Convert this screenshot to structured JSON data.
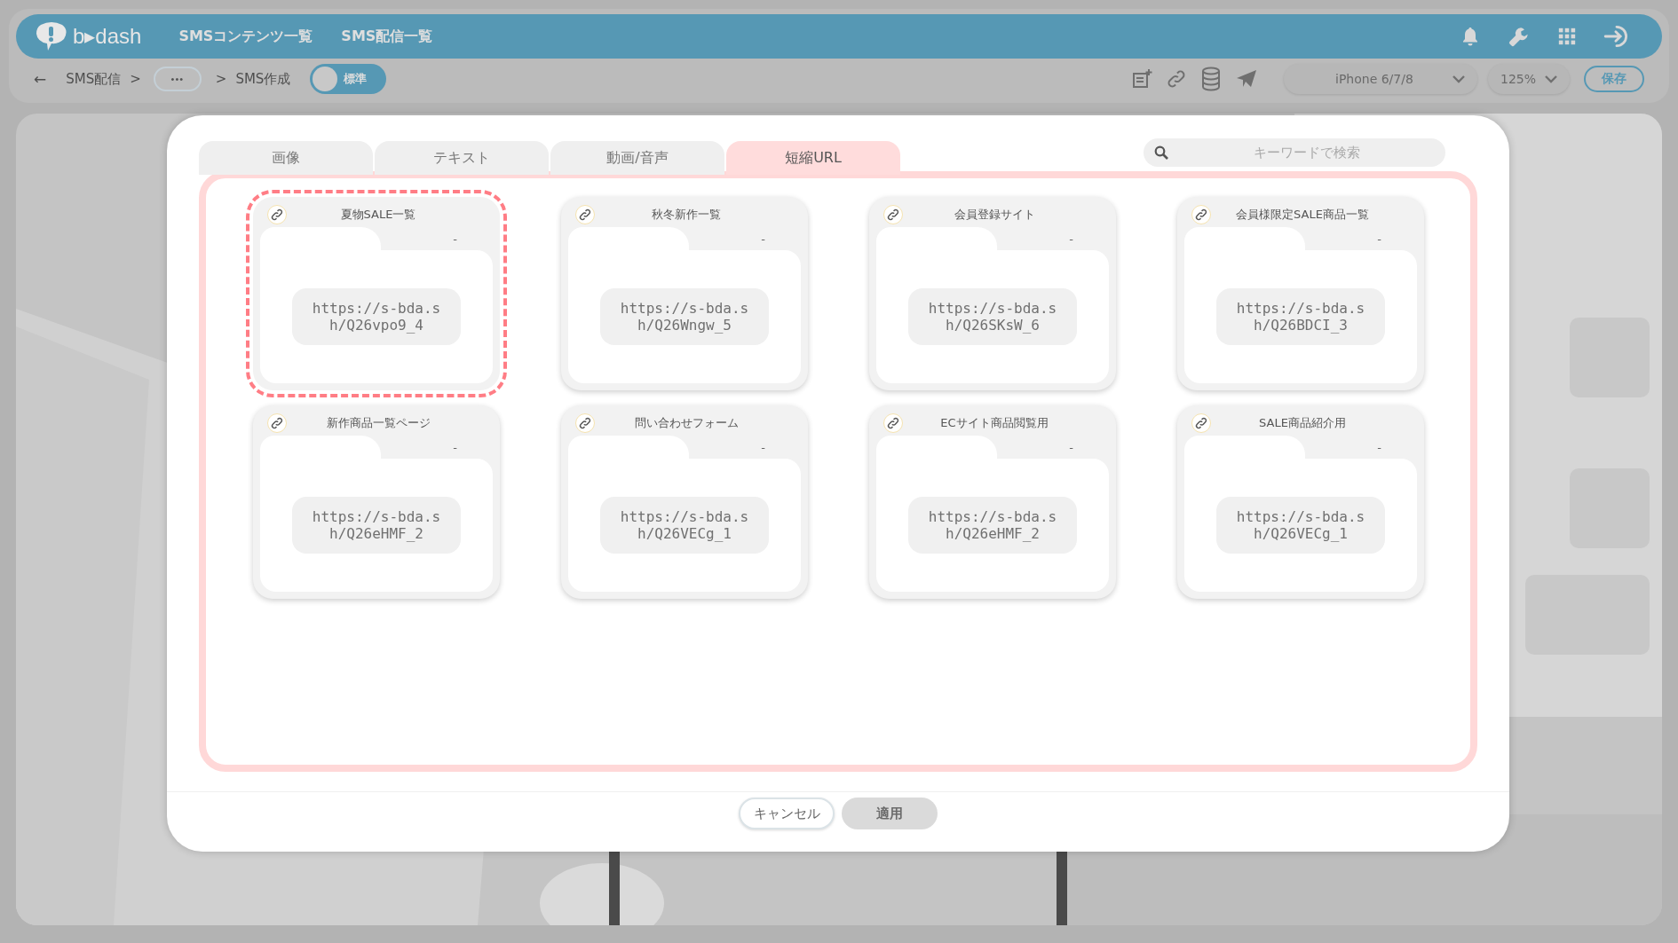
{
  "header": {
    "logo": "b▸dash",
    "nav": [
      "SMSコンテンツ一覧",
      "SMS配信一覧"
    ]
  },
  "toolbar": {
    "back": "←",
    "breadcrumb": [
      "SMS配信",
      ">"
    ],
    "more": "•••",
    "current": [
      ">",
      "SMS作成"
    ],
    "mode_toggle": {
      "label": "標準",
      "on": false
    },
    "device": "iPhone 6/7/8",
    "zoom": "125%",
    "save": "保存"
  },
  "modal": {
    "tabs": [
      {
        "label": "画像",
        "selected": false
      },
      {
        "label": "テキスト",
        "selected": false
      },
      {
        "label": "動画/音声",
        "selected": false
      },
      {
        "label": "短縮URL",
        "selected": true
      }
    ],
    "search": {
      "placeholder": "キーワードで検索"
    },
    "cards": [
      {
        "title": "夏物SALE一覧",
        "description": "-",
        "url": "https://s-bda.sh/Q26vpo9_4",
        "selected": true
      },
      {
        "title": "秋冬新作一覧",
        "description": "-",
        "url": "https://s-bda.sh/Q26Wngw_5",
        "selected": false
      },
      {
        "title": "会員登録サイト",
        "description": "-",
        "url": "https://s-bda.sh/Q26SKsW_6",
        "selected": false
      },
      {
        "title": "会員様限定SALE商品一覧",
        "description": "-",
        "url": "https://s-bda.sh/Q26BDCI_3",
        "selected": false
      },
      {
        "title": "新作商品一覧ページ",
        "description": "-",
        "url": "https://s-bda.sh/Q26eHMF_2",
        "selected": false
      },
      {
        "title": "問い合わせフォーム",
        "description": "-",
        "url": "https://s-bda.sh/Q26VECg_1",
        "selected": false
      },
      {
        "title": "ECサイト商品閲覧用",
        "description": "-",
        "url": "https://s-bda.sh/Q26eHMF_2",
        "selected": false
      },
      {
        "title": "SALE商品紹介用",
        "description": "-",
        "url": "https://s-bda.sh/Q26VECg_1",
        "selected": false
      }
    ],
    "cancel": {
      "label": "キャンセル"
    },
    "apply": {
      "label": "適用",
      "disabled": true
    }
  }
}
